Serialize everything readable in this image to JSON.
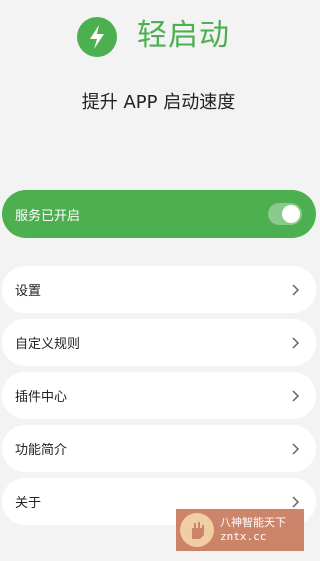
{
  "header": {
    "app_title": "轻启动",
    "subtitle": "提升 APP 启动速度",
    "logo_icon": "lightning-bolt-icon",
    "accent_color": "#4caf50"
  },
  "service_status": {
    "label": "服务已开启",
    "toggle_on": true
  },
  "menu": {
    "items": [
      {
        "label": "设置"
      },
      {
        "label": "自定义规则"
      },
      {
        "label": "插件中心"
      },
      {
        "label": "功能简介"
      },
      {
        "label": "关于"
      }
    ]
  },
  "watermark": {
    "line1": "八神智能天下",
    "line2": "zntx.cc"
  }
}
